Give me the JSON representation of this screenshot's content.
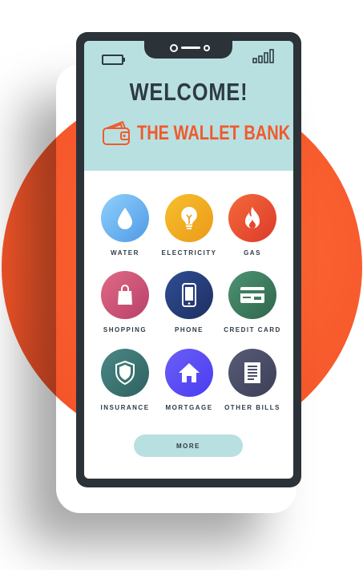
{
  "header": {
    "greeting": "WELCOME!",
    "brand_name": "THE WALLET BANK",
    "brand_icon": "wallet-icon",
    "status": {
      "battery_icon": "battery-icon",
      "signal_icon": "signal-icon"
    }
  },
  "services": [
    {
      "label": "WATER",
      "icon": "water-drop-icon",
      "color": "#6fb8f2"
    },
    {
      "label": "ELECTRICITY",
      "icon": "lightbulb-icon",
      "color": "#f0a91e"
    },
    {
      "label": "GAS",
      "icon": "flame-icon",
      "color": "#e8452c"
    },
    {
      "label": "SHOPPING",
      "icon": "shopping-bag-icon",
      "color": "#cf5275"
    },
    {
      "label": "PHONE",
      "icon": "smartphone-icon",
      "color": "#253e79"
    },
    {
      "label": "CREDIT CARD",
      "icon": "credit-card-icon",
      "color": "#3f7d5e"
    },
    {
      "label": "INSURANCE",
      "icon": "shield-icon",
      "color": "#3a7775"
    },
    {
      "label": "MORTGAGE",
      "icon": "house-icon",
      "color": "#5a4ef5"
    },
    {
      "label": "OTHER BILLS",
      "icon": "receipt-icon",
      "color": "#4a4e68"
    }
  ],
  "more_button": {
    "label": "MORE"
  },
  "colors": {
    "accent": "#f05a2c",
    "header_bg": "#b9e0e1",
    "phone_frame": "#2b3238",
    "text_dark": "#2e3a45"
  }
}
